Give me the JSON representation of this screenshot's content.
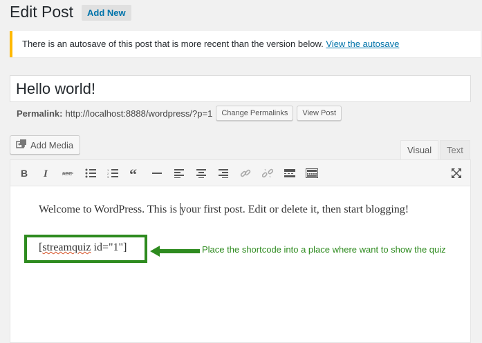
{
  "header": {
    "title": "Edit Post",
    "add_new_label": "Add New"
  },
  "notice": {
    "text": "There is an autosave of this post that is more recent than the version below.",
    "link_label": "View the autosave"
  },
  "post": {
    "title": "Hello world!"
  },
  "permalink": {
    "label": "Permalink:",
    "url": "http://localhost:8888/wordpress/?p=1",
    "change_label": "Change Permalinks",
    "view_label": "View Post"
  },
  "media": {
    "add_media_label": "Add Media"
  },
  "editor": {
    "tabs": {
      "visual": "Visual",
      "text": "Text"
    },
    "toolbar": [
      "bold-icon",
      "italic-icon",
      "strikethrough-icon",
      "bullet-list-icon",
      "numbered-list-icon",
      "blockquote-icon",
      "horizontal-rule-icon",
      "align-left-icon",
      "align-center-icon",
      "align-right-icon",
      "link-icon",
      "unlink-icon",
      "read-more-icon",
      "toolbar-toggle-icon",
      "fullscreen-icon"
    ],
    "content_line1_a": "Welcome to WordPress. This is ",
    "content_line1_b": "your first post. Edit or delete it, then start blogging!",
    "shortcode_open": "[",
    "shortcode_name": "streamquiz",
    "shortcode_rest": " id=\"1\"]"
  },
  "annotation": {
    "text": "Place the shortcode into a place where want to show the quiz",
    "color": "#2e8b1f"
  }
}
